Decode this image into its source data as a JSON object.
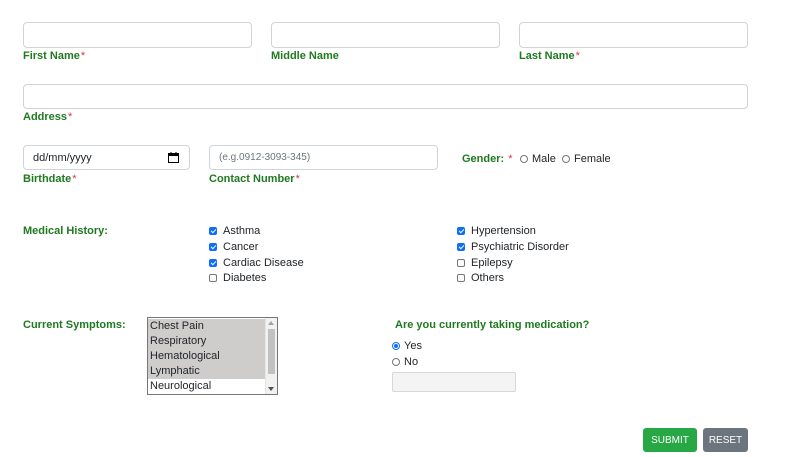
{
  "fields": {
    "first_name": {
      "label": "First Name",
      "required_mark": "*",
      "value": ""
    },
    "middle_name": {
      "label": "Middle Name",
      "value": ""
    },
    "last_name": {
      "label": "Last Name",
      "required_mark": "*",
      "value": ""
    },
    "address": {
      "label": "Address",
      "required_mark": "*",
      "value": ""
    },
    "birthdate": {
      "label": "Birthdate",
      "required_mark": "*",
      "placeholder": "dd/mm/yyyy"
    },
    "contact": {
      "label": "Contact Number",
      "required_mark": "*",
      "placeholder": "(e.g.0912-3093-345)"
    }
  },
  "gender": {
    "label": "Gender:",
    "required_mark": "*",
    "options": [
      "Male",
      "Female"
    ]
  },
  "medical_history": {
    "label": "Medical History:",
    "col1": [
      {
        "label": "Asthma",
        "checked": true
      },
      {
        "label": "Cancer",
        "checked": true
      },
      {
        "label": "Cardiac Disease",
        "checked": true
      },
      {
        "label": "Diabetes",
        "checked": false
      }
    ],
    "col2": [
      {
        "label": "Hypertension",
        "checked": true
      },
      {
        "label": "Psychiatric Disorder",
        "checked": true
      },
      {
        "label": "Epilepsy",
        "checked": false
      },
      {
        "label": "Others",
        "checked": false
      }
    ]
  },
  "symptoms": {
    "label": "Current Symptoms:",
    "items": [
      {
        "label": "Chest Pain",
        "selected": true
      },
      {
        "label": "Respiratory",
        "selected": true
      },
      {
        "label": "Hematological",
        "selected": true
      },
      {
        "label": "Lymphatic",
        "selected": true
      },
      {
        "label": "Neurological",
        "selected": false
      }
    ]
  },
  "medication": {
    "question": "Are you currently taking medication?",
    "options": [
      {
        "label": "Yes",
        "checked": true
      },
      {
        "label": "No",
        "checked": false
      }
    ],
    "details_value": ""
  },
  "buttons": {
    "submit": "SUBMIT",
    "reset": "RESET"
  },
  "colors": {
    "label_green": "#1f7a1f",
    "required_red": "#dc3545",
    "submit_green": "#28a745",
    "reset_gray": "#6c757d",
    "accent_blue": "#0d6efd"
  }
}
